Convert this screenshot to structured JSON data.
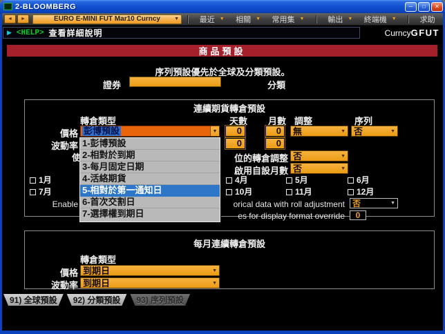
{
  "window": {
    "title": "2-BLOOMBERG"
  },
  "icons": {
    "back": "◄",
    "forward": "►",
    "arrow_down": "▼",
    "play": "▶",
    "minimize": "─",
    "maximize": "□",
    "close": "✕"
  },
  "toolbar": {
    "security": "EURO E-MINI FUT Mar10 Curncy",
    "menus": [
      "最近",
      "相關",
      "常用集",
      "輸出",
      "終端機",
      "求助"
    ]
  },
  "header": {
    "help_tag": "<HELP>",
    "description": "查看詳細說明",
    "brand_left": "Curncy",
    "brand_right": "GFUT"
  },
  "banner": {
    "title": "商品預設"
  },
  "intro": {
    "note": "序列預設優先於全球及分類預設。",
    "security_label": "證券",
    "security_value": "",
    "category_label": "分類"
  },
  "roll_panel": {
    "title": "連續期貨轉倉預設",
    "headers": {
      "roll_type": "轉倉類型",
      "days": "天數",
      "months": "月數",
      "adjust": "調整",
      "series": "序列"
    },
    "price": {
      "label": "價格",
      "roll_type": "彭博預設",
      "days": "0",
      "months": "0",
      "adjust": "無",
      "series": "否"
    },
    "volatility": {
      "label": "波動率",
      "days": "0",
      "months": "0"
    },
    "partial_char": "使",
    "adjust_row": {
      "label": "位的轉倉調整",
      "value": "否"
    },
    "custom_months_row": {
      "label": "啟用自設月數",
      "value": "否"
    },
    "months_row1": [
      "1月",
      "4月",
      "5月",
      "6月"
    ],
    "months_row2": [
      "7月",
      "10月",
      "11月",
      "12月"
    ],
    "enable_row": {
      "prefix": "Enable",
      "suffix": "orical data with roll adjustment",
      "value": "否"
    },
    "override_row": {
      "suffix": "es for display format override",
      "value": "0"
    }
  },
  "roll_dropdown": {
    "items": [
      "1-彭博預設",
      "2-相對於到期",
      "3-每月固定日期",
      "4-活絡期貨",
      "5-相對於第一通知日",
      "6-首次交割日",
      "7-選擇權到期日"
    ],
    "highlighted": "5-相對於第一通知日"
  },
  "monthly_panel": {
    "title": "每月連續轉倉預設",
    "header_roll_type": "轉倉類型",
    "price_label": "價格",
    "price_value": "到期日",
    "volatility_label": "波動率",
    "volatility_value": "到期日"
  },
  "tabs": [
    "91) 全球預設",
    "92) 分類預設",
    "93) 序列預設"
  ],
  "colors": {
    "xp_blue": "#0a43bd",
    "amber": "#efa017",
    "orange_red": "#e8650c",
    "banner_red": "#a6202c",
    "highlight_blue": "#2e77c8",
    "help_green": "#00d22a"
  }
}
